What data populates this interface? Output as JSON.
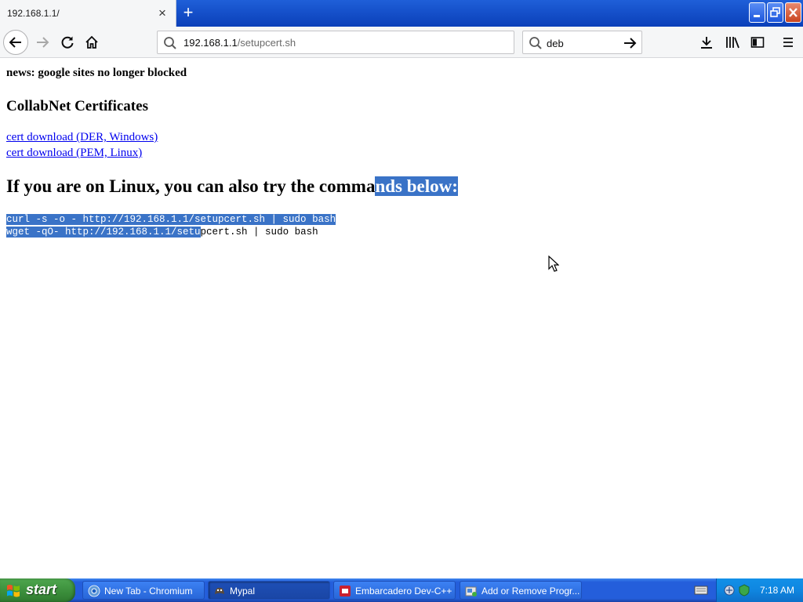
{
  "browser": {
    "tab": {
      "title": "192.168.1.1/"
    },
    "url": {
      "host": "192.168.1.1",
      "path": "/setupcert.sh"
    },
    "search": {
      "value": "deb"
    },
    "icons": [
      "back-icon",
      "forward-icon",
      "reload-icon",
      "home-icon",
      "search-icon",
      "arrow-right-icon",
      "download-icon",
      "library-icon",
      "sidebar-icon",
      "hamburger-menu-icon",
      "close-icon",
      "plus-icon"
    ]
  },
  "page": {
    "news": "news: google sites no longer blocked",
    "certs_title": "CollabNet Certificates",
    "link_der": "cert download (DER, Windows)",
    "link_pem": "cert download (PEM, Linux)",
    "linux_heading_plain": "If you are on Linux, you can also try the comma",
    "linux_heading_selected": "nds below:",
    "cmd_curl": "curl -s -o - http://192.168.1.1/setupcert.sh | sudo bash",
    "cmd_wget_selected": "wget -qO- http://192.168.1.1/setu",
    "cmd_wget_plain": "pcert.sh | sudo bash",
    "selection_color": "#3a73c7",
    "link_color": "#0000ee"
  },
  "taskbar": {
    "start_label": "start",
    "tasks": [
      {
        "label": "New Tab - Chromium"
      },
      {
        "label": "Mypal"
      },
      {
        "label": "Embarcadero Dev-C++"
      },
      {
        "label": "Add or Remove Progr..."
      }
    ],
    "clock": "7:18 AM"
  }
}
